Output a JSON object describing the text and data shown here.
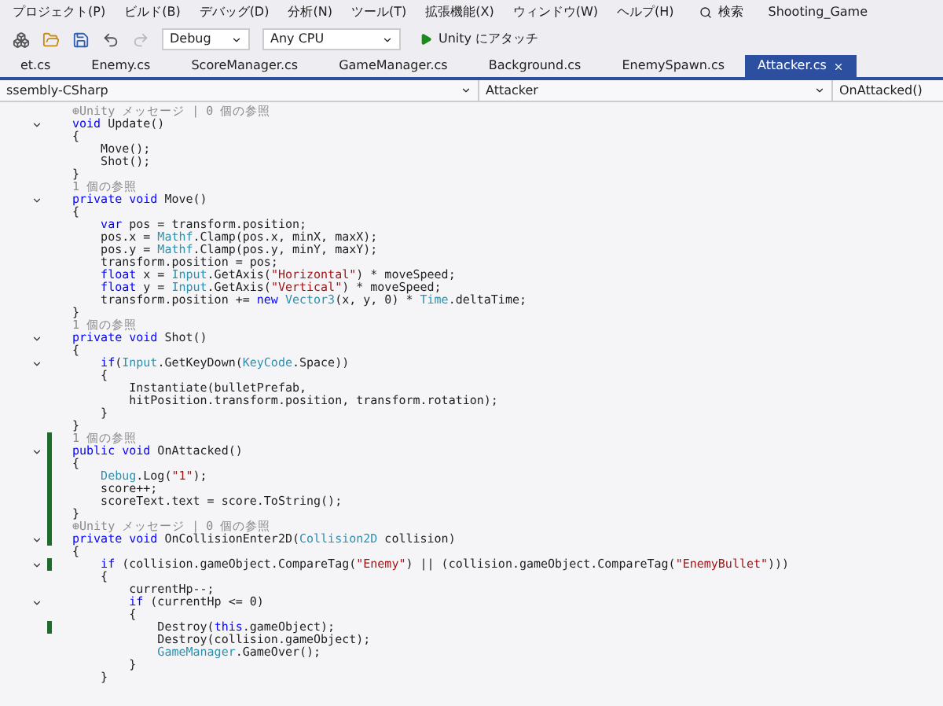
{
  "menu": [
    "プロジェクト(P)",
    "ビルド(B)",
    "デバッグ(D)",
    "分析(N)",
    "ツール(T)",
    "拡張機能(X)",
    "ウィンドウ(W)",
    "ヘルプ(H)"
  ],
  "search": {
    "label": "検索"
  },
  "solution": "Shooting_Game",
  "toolbar": {
    "configuration": "Debug",
    "platform": "Any CPU",
    "attach": "Unity にアタッチ"
  },
  "tabs": [
    {
      "label": "et.cs",
      "selected": false
    },
    {
      "label": "Enemy.cs",
      "selected": false
    },
    {
      "label": "ScoreManager.cs",
      "selected": false
    },
    {
      "label": "GameManager.cs",
      "selected": false
    },
    {
      "label": "Background.cs",
      "selected": false
    },
    {
      "label": "EnemySpawn.cs",
      "selected": false
    },
    {
      "label": "Attacker.cs",
      "selected": true
    }
  ],
  "navbar": {
    "project": "ssembly-CSharp",
    "class": "Attacker",
    "member": "OnAttacked()"
  },
  "lines": [
    {
      "fold": false,
      "changed": false,
      "segments": [
        {
          "kind": "hint",
          "text": "⊕Unity メッセージ | 0 個の参照"
        }
      ]
    },
    {
      "fold": true,
      "changed": false,
      "segments": [
        {
          "kind": "kw",
          "text": "void"
        },
        {
          "kind": "plain",
          "text": " Update()"
        }
      ]
    },
    {
      "fold": false,
      "changed": false,
      "segments": [
        {
          "kind": "plain",
          "text": "{"
        }
      ]
    },
    {
      "fold": false,
      "changed": false,
      "segments": [
        {
          "kind": "plain",
          "text": "    Move();"
        }
      ]
    },
    {
      "fold": false,
      "changed": false,
      "segments": [
        {
          "kind": "plain",
          "text": "    Shot();"
        }
      ]
    },
    {
      "fold": false,
      "changed": false,
      "segments": [
        {
          "kind": "plain",
          "text": "}"
        }
      ]
    },
    {
      "fold": false,
      "changed": false,
      "segments": [
        {
          "kind": "hint",
          "text": "1 個の参照"
        }
      ]
    },
    {
      "fold": true,
      "changed": false,
      "segments": [
        {
          "kind": "kw",
          "text": "private void"
        },
        {
          "kind": "plain",
          "text": " Move()"
        }
      ]
    },
    {
      "fold": false,
      "changed": false,
      "segments": [
        {
          "kind": "plain",
          "text": "{"
        }
      ]
    },
    {
      "fold": false,
      "changed": false,
      "segments": [
        {
          "kind": "kw",
          "text": "    var"
        },
        {
          "kind": "plain",
          "text": " pos = transform.position;"
        }
      ]
    },
    {
      "fold": false,
      "changed": false,
      "segments": [
        {
          "kind": "plain",
          "text": "    pos.x ="
        },
        {
          "kind": "type",
          "text": " Mathf"
        },
        {
          "kind": "plain",
          "text": ".Clamp(pos.x, minX, maxX);"
        }
      ]
    },
    {
      "fold": false,
      "changed": false,
      "segments": [
        {
          "kind": "plain",
          "text": "    pos.y ="
        },
        {
          "kind": "type",
          "text": " Mathf"
        },
        {
          "kind": "plain",
          "text": ".Clamp(pos.y, minY, maxY);"
        }
      ]
    },
    {
      "fold": false,
      "changed": false,
      "segments": [
        {
          "kind": "plain",
          "text": "    transform.position = pos;"
        }
      ]
    },
    {
      "fold": false,
      "changed": false,
      "segments": [
        {
          "kind": "kw",
          "text": "    float"
        },
        {
          "kind": "plain",
          "text": " x ="
        },
        {
          "kind": "type",
          "text": " Input"
        },
        {
          "kind": "plain",
          "text": ".GetAxis("
        },
        {
          "kind": "str",
          "text": "\"Horizontal\""
        },
        {
          "kind": "plain",
          "text": ") * moveSpeed;"
        }
      ]
    },
    {
      "fold": false,
      "changed": false,
      "segments": [
        {
          "kind": "kw",
          "text": "    float"
        },
        {
          "kind": "plain",
          "text": " y ="
        },
        {
          "kind": "type",
          "text": " Input"
        },
        {
          "kind": "plain",
          "text": ".GetAxis("
        },
        {
          "kind": "str",
          "text": "\"Vertical\""
        },
        {
          "kind": "plain",
          "text": ") * moveSpeed;"
        }
      ]
    },
    {
      "fold": false,
      "changed": false,
      "segments": [
        {
          "kind": "plain",
          "text": "    transform.position +="
        },
        {
          "kind": "kw",
          "text": " new"
        },
        {
          "kind": "type",
          "text": " Vector3"
        },
        {
          "kind": "plain",
          "text": "(x, y, 0) *"
        },
        {
          "kind": "type",
          "text": " Time"
        },
        {
          "kind": "plain",
          "text": ".deltaTime;"
        }
      ]
    },
    {
      "fold": false,
      "changed": false,
      "segments": [
        {
          "kind": "plain",
          "text": "}"
        }
      ]
    },
    {
      "fold": false,
      "changed": false,
      "segments": [
        {
          "kind": "hint",
          "text": "1 個の参照"
        }
      ]
    },
    {
      "fold": true,
      "changed": false,
      "segments": [
        {
          "kind": "kw",
          "text": "private void"
        },
        {
          "kind": "plain",
          "text": " Shot()"
        }
      ]
    },
    {
      "fold": false,
      "changed": false,
      "segments": [
        {
          "kind": "plain",
          "text": "{"
        }
      ]
    },
    {
      "fold": true,
      "changed": false,
      "segments": [
        {
          "kind": "kw",
          "text": "    if"
        },
        {
          "kind": "plain",
          "text": "("
        },
        {
          "kind": "type",
          "text": "Input"
        },
        {
          "kind": "plain",
          "text": ".GetKeyDown("
        },
        {
          "kind": "type",
          "text": "KeyCode"
        },
        {
          "kind": "plain",
          "text": ".Space))"
        }
      ]
    },
    {
      "fold": false,
      "changed": false,
      "segments": [
        {
          "kind": "plain",
          "text": "    {"
        }
      ]
    },
    {
      "fold": false,
      "changed": false,
      "segments": [
        {
          "kind": "plain",
          "text": "        Instantiate(bulletPrefab,"
        }
      ]
    },
    {
      "fold": false,
      "changed": false,
      "segments": [
        {
          "kind": "plain",
          "text": "        hitPosition.transform.position, transform.rotation);"
        }
      ]
    },
    {
      "fold": false,
      "changed": false,
      "segments": [
        {
          "kind": "plain",
          "text": "    }"
        }
      ]
    },
    {
      "fold": false,
      "changed": false,
      "segments": [
        {
          "kind": "plain",
          "text": "}"
        }
      ]
    },
    {
      "fold": false,
      "changed": true,
      "segments": [
        {
          "kind": "hint",
          "text": "1 個の参照"
        }
      ]
    },
    {
      "fold": true,
      "changed": true,
      "segments": [
        {
          "kind": "kw",
          "text": "public void"
        },
        {
          "kind": "plain",
          "text": " OnAttacked()"
        }
      ]
    },
    {
      "fold": false,
      "changed": true,
      "segments": [
        {
          "kind": "plain",
          "text": "{"
        }
      ]
    },
    {
      "fold": false,
      "changed": true,
      "segments": [
        {
          "kind": "type",
          "text": "    Debug"
        },
        {
          "kind": "plain",
          "text": ".Log("
        },
        {
          "kind": "str",
          "text": "\"1\""
        },
        {
          "kind": "plain",
          "text": ");"
        }
      ]
    },
    {
      "fold": false,
      "changed": true,
      "segments": [
        {
          "kind": "plain",
          "text": "    score++;"
        }
      ]
    },
    {
      "fold": false,
      "changed": true,
      "segments": [
        {
          "kind": "plain",
          "text": "    scoreText.text = score.ToString();"
        }
      ]
    },
    {
      "fold": false,
      "changed": true,
      "segments": [
        {
          "kind": "plain",
          "text": "}"
        }
      ]
    },
    {
      "fold": false,
      "changed": true,
      "segments": [
        {
          "kind": "hint",
          "text": "⊕Unity メッセージ | 0 個の参照"
        }
      ]
    },
    {
      "fold": true,
      "changed": true,
      "segments": [
        {
          "kind": "kw",
          "text": "private void"
        },
        {
          "kind": "plain",
          "text": " OnCollisionEnter2D("
        },
        {
          "kind": "type",
          "text": "Collision2D"
        },
        {
          "kind": "plain",
          "text": " collision)"
        }
      ]
    },
    {
      "fold": false,
      "changed": false,
      "segments": [
        {
          "kind": "plain",
          "text": "{"
        }
      ]
    },
    {
      "fold": true,
      "changed": true,
      "segments": [
        {
          "kind": "kw",
          "text": "    if"
        },
        {
          "kind": "plain",
          "text": " (collision.gameObject.CompareTag("
        },
        {
          "kind": "str",
          "text": "\"Enemy\""
        },
        {
          "kind": "plain",
          "text": ") || (collision.gameObject.CompareTag("
        },
        {
          "kind": "str",
          "text": "\"EnemyBullet\""
        },
        {
          "kind": "plain",
          "text": ")))"
        }
      ]
    },
    {
      "fold": false,
      "changed": false,
      "segments": [
        {
          "kind": "plain",
          "text": "    {"
        }
      ]
    },
    {
      "fold": false,
      "changed": false,
      "segments": [
        {
          "kind": "plain",
          "text": "        currentHp--;"
        }
      ]
    },
    {
      "fold": true,
      "changed": false,
      "segments": [
        {
          "kind": "kw",
          "text": "        if"
        },
        {
          "kind": "plain",
          "text": " (currentHp <= 0)"
        }
      ]
    },
    {
      "fold": false,
      "changed": false,
      "segments": [
        {
          "kind": "plain",
          "text": "        {"
        }
      ]
    },
    {
      "fold": false,
      "changed": true,
      "segments": [
        {
          "kind": "plain",
          "text": "            Destroy("
        },
        {
          "kind": "kw",
          "text": "this"
        },
        {
          "kind": "plain",
          "text": ".gameObject);"
        }
      ]
    },
    {
      "fold": false,
      "changed": false,
      "segments": [
        {
          "kind": "plain",
          "text": "            Destroy(collision.gameObject);"
        }
      ]
    },
    {
      "fold": false,
      "changed": false,
      "segments": [
        {
          "kind": "type",
          "text": "            GameManager"
        },
        {
          "kind": "plain",
          "text": ".GameOver();"
        }
      ]
    },
    {
      "fold": false,
      "changed": false,
      "segments": [
        {
          "kind": "plain",
          "text": "        }"
        }
      ]
    },
    {
      "fold": false,
      "changed": false,
      "segments": [
        {
          "kind": "plain",
          "text": "    }"
        }
      ]
    }
  ]
}
